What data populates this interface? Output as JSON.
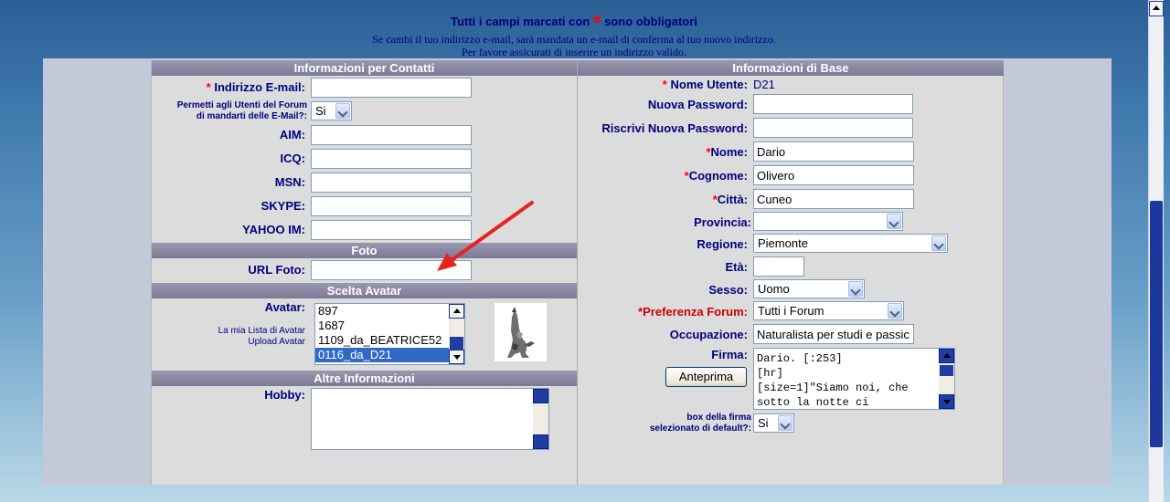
{
  "header": {
    "required_note_before": "Tutti i campi marcati con",
    "required_star": "*",
    "required_note_after": "sono obbligatori",
    "email_change_note": "Se cambi il tuo indirizzo e-mail, sarà mandata un e-mail di conferma al tuo nuovo indirizzo.",
    "valid_email_note": "Per favore assicurati di inserire un indirizzo valido."
  },
  "sections": {
    "contact": "Informazioni per Contatti",
    "photo": "Foto",
    "avatar": "Scelta Avatar",
    "other": "Altre Informazioni",
    "base": "Informazioni di Base"
  },
  "contact": {
    "email_star": "*",
    "email_label": "Indirizzo E-mail:",
    "email_value": "",
    "allow_email_label_1": "Permetti agli Utenti del Forum",
    "allow_email_label_2": "di mandarti delle E-Mail?:",
    "allow_email_value": "Si",
    "aim_label": "AIM:",
    "icq_label": "ICQ:",
    "msn_label": "MSN:",
    "skype_label": "SKYPE:",
    "yahoo_label": "YAHOO IM:"
  },
  "photo": {
    "url_label": "URL Foto:",
    "url_value": ""
  },
  "avatar": {
    "label": "Avatar:",
    "my_list_link": "La mia Lista di Avatar",
    "upload_link": "Upload Avatar",
    "options": [
      "897",
      "1687",
      "1109_da_BEATRICE52",
      "0116_da_D21"
    ],
    "selected_index": 3
  },
  "other": {
    "hobby_label": "Hobby:",
    "hobby_value": ""
  },
  "base": {
    "username_star": "*",
    "username_label": "Nome Utente:",
    "username_value": "D21",
    "new_password_label": "Nuova Password:",
    "repeat_password_label": "Riscrivi Nuova Password:",
    "name_star": "*",
    "name_label": "Nome:",
    "name_value": "Dario",
    "surname_star": "*",
    "surname_label": "Cognome:",
    "surname_value": "Olivero",
    "city_star": "*",
    "city_label": "Città:",
    "city_value": "Cuneo",
    "province_label": "Provincia:",
    "province_value": "",
    "region_label": "Regione:",
    "region_value": "Piemonte",
    "age_label": "Età:",
    "age_value": "",
    "sex_label": "Sesso:",
    "sex_value": "Uomo",
    "forum_pref_label": "*Preferenza Forum:",
    "forum_pref_value": "Tutti i Forum",
    "occupation_label": "Occupazione:",
    "occupation_value": "Naturalista per studi e passic",
    "signature_label": "Firma:",
    "signature_value": "Dario. [:253]\n[hr]\n[size=1]\"Siamo noi, che\nsotto la notte ci",
    "preview_button": "Anteprima",
    "sig_default_label_1": "box della firma",
    "sig_default_label_2": "selezionato di default?:",
    "sig_default_value": "Si"
  },
  "colors": {
    "label_text": "#000080",
    "required_star": "#ff0000",
    "section_header": "#8a88a2",
    "form_bg": "#dcdcdc",
    "selected_option": "#316ac5",
    "annotation_arrow": "#e8231f"
  }
}
